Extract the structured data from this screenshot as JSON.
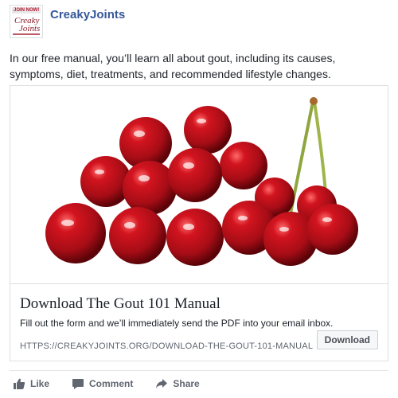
{
  "post": {
    "page_name": "CreakyJoints",
    "avatar": {
      "badge_text": "JOIN NOW!",
      "logo_line1": "Creaky",
      "logo_line2": "Joints"
    },
    "text": "In our free manual, you’ll learn all about gout, including its causes, symptoms, diet, treatments, and recommended lifestyle changes."
  },
  "card": {
    "image_alt": "cherries-image",
    "title": "Download The Gout 101 Manual",
    "description": "Fill out the form and we’ll immediately send the PDF into your email inbox.",
    "url": "HTTPS://CREAKYJOINTS.ORG/DOWNLOAD-THE-GOUT-101-MANUAL",
    "button_label": "Download"
  },
  "actions": [
    {
      "label": "Like",
      "icon": "thumbs-up-icon"
    },
    {
      "label": "Comment",
      "icon": "comment-icon"
    },
    {
      "label": "Share",
      "icon": "share-icon"
    }
  ],
  "colors": {
    "link": "#365899",
    "text": "#1d2129",
    "muted": "#606770",
    "border": "#dddfe2",
    "cherry": "#b0101c"
  }
}
